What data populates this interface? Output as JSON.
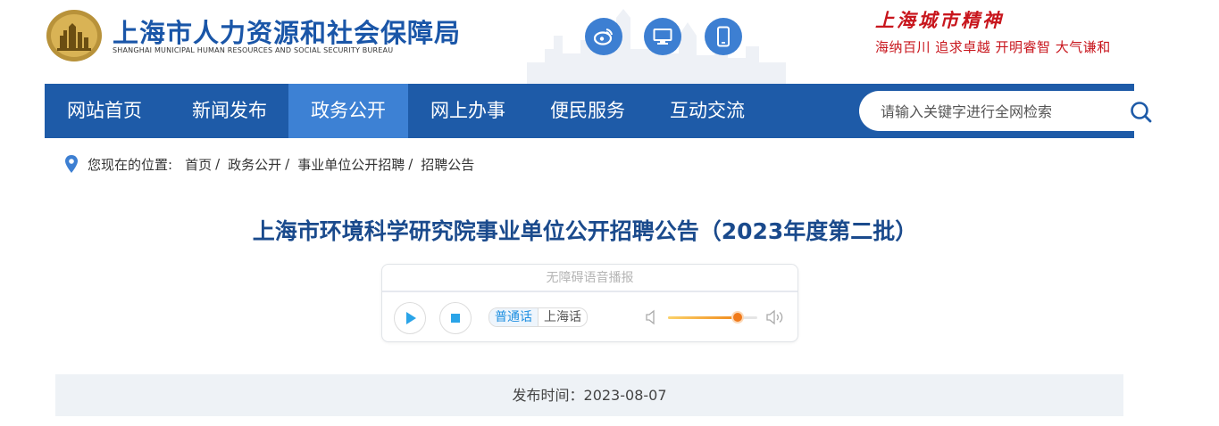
{
  "header": {
    "org_title": "上海市人力资源和社会保障局",
    "org_subtitle": "SHANGHAI MUNICIPAL HUMAN RESOURCES AND SOCIAL SECURITY BUREAU",
    "icons": [
      "weibo-icon",
      "desktop-icon",
      "mobile-icon"
    ],
    "spirit_title": "上海城市精神",
    "spirit_slogan": "海纳百川  追求卓越  开明睿智  大气谦和"
  },
  "nav": {
    "items": [
      {
        "label": "网站首页",
        "active": false
      },
      {
        "label": "新闻发布",
        "active": false
      },
      {
        "label": "政务公开",
        "active": true
      },
      {
        "label": "网上办事",
        "active": false
      },
      {
        "label": "便民服务",
        "active": false
      },
      {
        "label": "互动交流",
        "active": false
      }
    ],
    "search_placeholder": "请输入关键字进行全网检索"
  },
  "breadcrumb": {
    "prefix": "您现在的位置:",
    "items": [
      "首页",
      "政务公开",
      "事业单位公开招聘",
      "招聘公告"
    ],
    "separator": "/"
  },
  "article": {
    "title": "上海市环境科学研究院事业单位公开招聘公告（2023年度第二批）",
    "publish_label": "发布时间：",
    "publish_date": "2023-08-07"
  },
  "player": {
    "title": "无障碍语音播报",
    "lang_options": [
      "普通话",
      "上海话"
    ],
    "selected_lang": "普通话",
    "volume_level": 0.78
  },
  "colors": {
    "brand_blue": "#1e5ba8",
    "nav_active": "#3d81d4",
    "spirit_red": "#c8161d",
    "title_blue": "#1a4a8c"
  }
}
